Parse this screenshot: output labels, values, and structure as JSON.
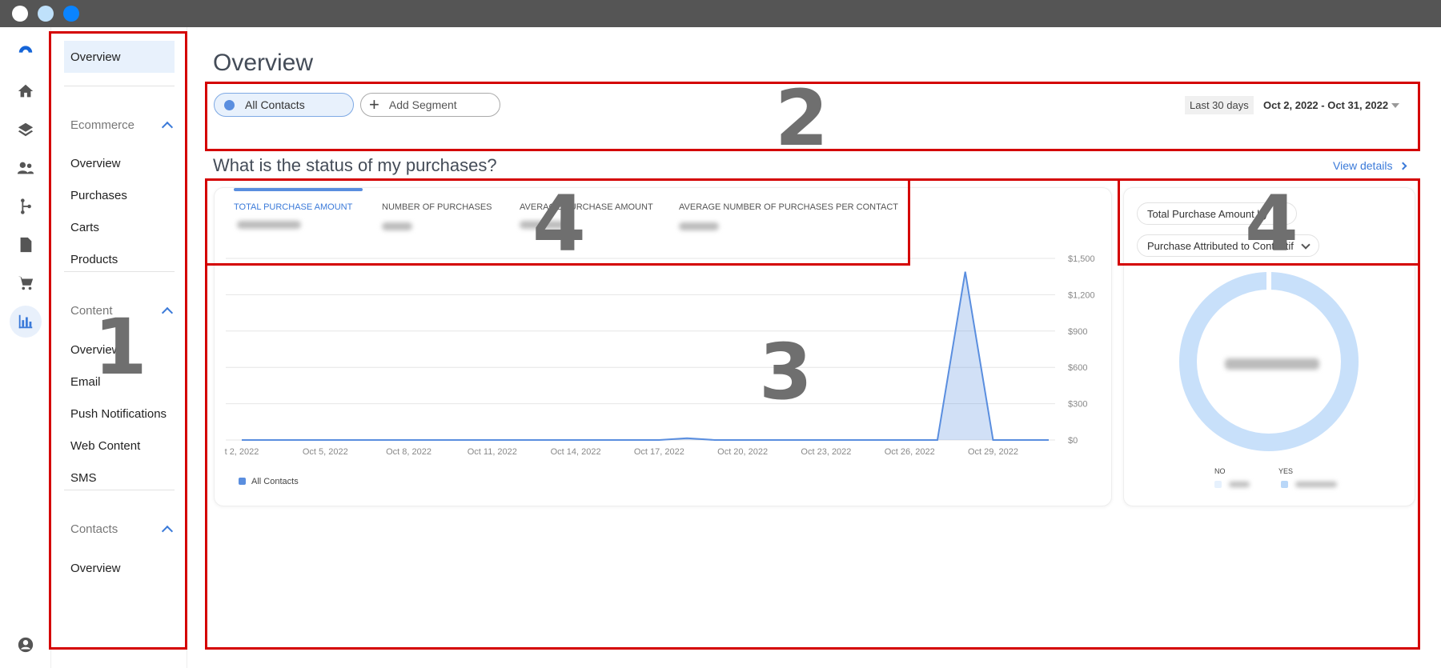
{
  "window": {
    "dots": [
      "#ffffff",
      "#bfe1fb",
      "#0a84ff"
    ]
  },
  "rail": {
    "icons": [
      "logo-icon",
      "home-icon",
      "layers-icon",
      "people-icon",
      "flow-icon",
      "document-icon",
      "cart-icon",
      "chart-icon",
      "account-icon"
    ],
    "active": "chart-icon"
  },
  "subnav": {
    "top_item": "Overview",
    "ecommerce": {
      "label": "Ecommerce",
      "items": [
        "Overview",
        "Purchases",
        "Carts",
        "Products"
      ]
    },
    "content": {
      "label": "Content",
      "items": [
        "Overview",
        "Email",
        "Push Notifications",
        "Web Content",
        "SMS"
      ]
    },
    "contacts": {
      "label": "Contacts",
      "items": [
        "Overview"
      ]
    }
  },
  "page": {
    "title": "Overview"
  },
  "segments": {
    "all": "All Contacts",
    "add": "Add Segment"
  },
  "date": {
    "preset": "Last 30 days",
    "range": "Oct 2, 2022 - Oct 31, 2022"
  },
  "purchases": {
    "question": "What is the status of my purchases?",
    "view_details": "View details",
    "metrics": [
      "TOTAL PURCHASE AMOUNT",
      "NUMBER OF PURCHASES",
      "AVERAGE PURCHASE AMOUNT",
      "AVERAGE NUMBER OF PURCHASES PER CONTACT"
    ]
  },
  "donut_panel": {
    "select1": "Total Purchase Amount by",
    "select2": "Purchase Attributed to Contactif",
    "legend": [
      "NO",
      "YES"
    ]
  },
  "annotations": [
    "1",
    "2",
    "3",
    "4",
    "4"
  ],
  "colors": {
    "accent": "#3b7ad9",
    "series": "#5a8edf",
    "donut": "#c8e0fa",
    "annotation": "#d40000"
  },
  "chart_data": {
    "type": "area",
    "series": [
      {
        "name": "All Contacts",
        "x": [
          "Oct 2, 2022",
          "Oct 3, 2022",
          "Oct 4, 2022",
          "Oct 5, 2022",
          "Oct 6, 2022",
          "Oct 7, 2022",
          "Oct 8, 2022",
          "Oct 9, 2022",
          "Oct 10, 2022",
          "Oct 11, 2022",
          "Oct 12, 2022",
          "Oct 13, 2022",
          "Oct 14, 2022",
          "Oct 15, 2022",
          "Oct 16, 2022",
          "Oct 17, 2022",
          "Oct 18, 2022",
          "Oct 19, 2022",
          "Oct 20, 2022",
          "Oct 21, 2022",
          "Oct 22, 2022",
          "Oct 23, 2022",
          "Oct 24, 2022",
          "Oct 25, 2022",
          "Oct 26, 2022",
          "Oct 27, 2022",
          "Oct 28, 2022",
          "Oct 29, 2022",
          "Oct 30, 2022",
          "Oct 31, 2022"
        ],
        "values": [
          0,
          0,
          0,
          0,
          0,
          0,
          0,
          0,
          0,
          0,
          0,
          0,
          0,
          0,
          0,
          0,
          15,
          0,
          0,
          0,
          0,
          0,
          0,
          0,
          0,
          0,
          1390,
          0,
          0,
          0
        ]
      }
    ],
    "x_tick_labels": [
      "t 2, 2022",
      "Oct 5, 2022",
      "Oct 8, 2022",
      "Oct 11, 2022",
      "Oct 14, 2022",
      "Oct 17, 2022",
      "Oct 20, 2022",
      "Oct 23, 2022",
      "Oct 26, 2022",
      "Oct 29, 2022"
    ],
    "y_tick_labels": [
      "$0",
      "$300",
      "$600",
      "$900",
      "$1,200",
      "$1,500"
    ],
    "ylim": [
      0,
      1500
    ],
    "grid": true,
    "legend": "bottom-left"
  }
}
